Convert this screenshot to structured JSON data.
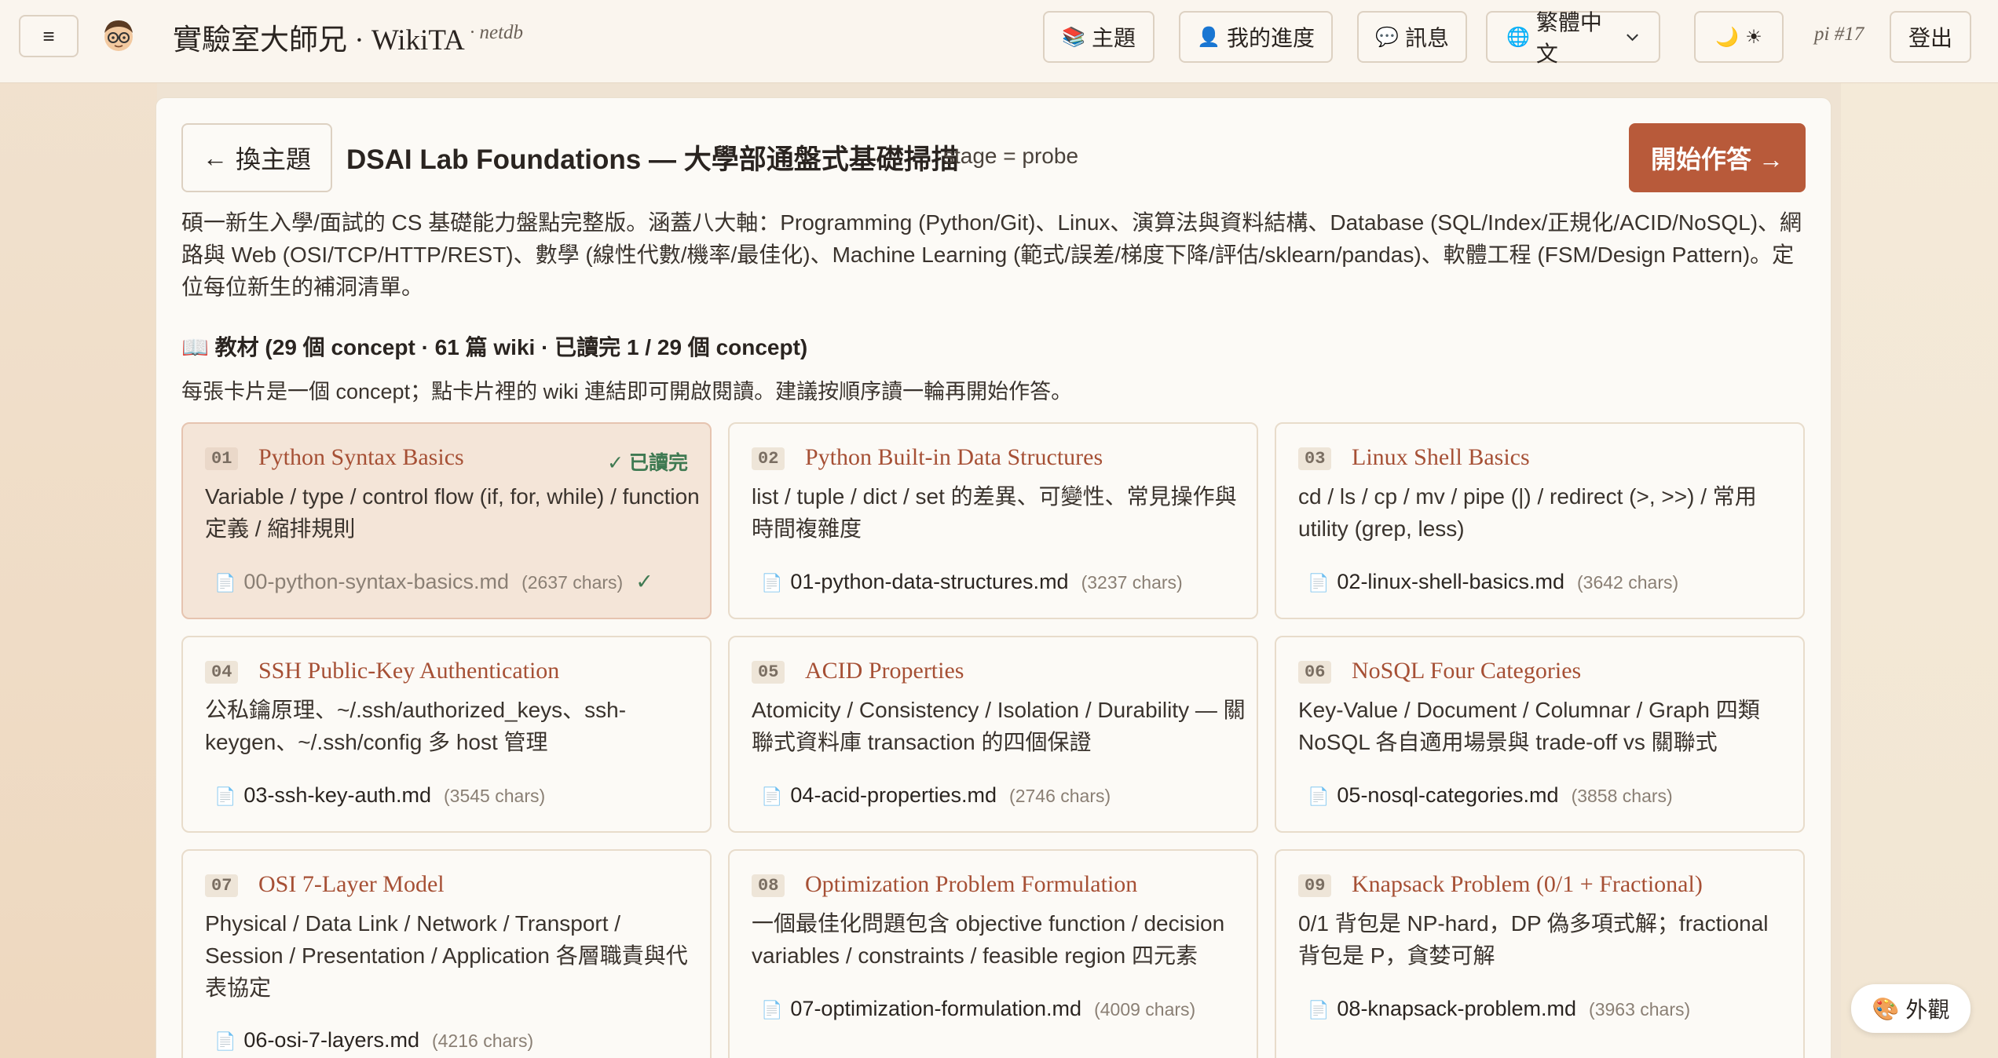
{
  "header": {
    "menu_icon": "hamburger-icon",
    "brand": "實驗室大師兄 · WikiTA",
    "brand_sub": "· netdb",
    "nav": {
      "topics": "主題",
      "progress": "我的進度",
      "messages": "訊息",
      "language": "繁體中文",
      "pi": "pi #17",
      "logout": "登出"
    }
  },
  "page": {
    "back_label": "換主題",
    "title": "DSAI Lab Foundations — 大學部通盤式基礎掃描",
    "stage": "stage = probe",
    "start_label": "開始作答 →",
    "description": "碩一新生入學/面試的 CS 基礎能力盤點完整版。涵蓋八大軸：Programming (Python/Git)、Linux、演算法與資料結構、Database (SQL/Index/正規化/ACID/NoSQL)、網路與 Web (OSI/TCP/HTTP/REST)、數學 (線性代數/機率/最佳化)、Machine Learning (範式/誤差/梯度下降/評估/sklearn/pandas)、軟體工程 (FSM/Design Pattern)。定位每位新生的補洞清單。",
    "section_head": "📖 教材 (29 個 concept · 61 篇 wiki · 已讀完 1 / 29 個 concept)",
    "section_sub": "每張卡片是一個 concept；點卡片裡的 wiki 連結即可開啟閱讀。建議按順序讀一輪再開始作答。"
  },
  "cards": [
    {
      "num": "01",
      "title": "Python Syntax Basics",
      "desc": "Variable / type / control flow (if, for, while) / function 定義 / 縮排規則",
      "file": "00-python-syntax-basics.md",
      "chars": "(2637 chars)",
      "read": true,
      "read_label": "✓ 已讀完",
      "check": "✓"
    },
    {
      "num": "02",
      "title": "Python Built-in Data Structures",
      "desc": "list / tuple / dict / set 的差異、可變性、常見操作與時間複雜度",
      "file": "01-python-data-structures.md",
      "chars": "(3237 chars)",
      "read": false
    },
    {
      "num": "03",
      "title": "Linux Shell Basics",
      "desc": "cd / ls / cp / mv / pipe (|) / redirect (>, >>) / 常用 utility (grep, less)",
      "file": "02-linux-shell-basics.md",
      "chars": "(3642 chars)",
      "read": false
    },
    {
      "num": "04",
      "title": "SSH Public-Key Authentication",
      "desc": "公私鑰原理、~/.ssh/authorized_keys、ssh-keygen、~/.ssh/config 多 host 管理",
      "file": "03-ssh-key-auth.md",
      "chars": "(3545 chars)",
      "read": false
    },
    {
      "num": "05",
      "title": "ACID Properties",
      "desc": "Atomicity / Consistency / Isolation / Durability — 關聯式資料庫 transaction 的四個保證",
      "file": "04-acid-properties.md",
      "chars": "(2746 chars)",
      "read": false
    },
    {
      "num": "06",
      "title": "NoSQL Four Categories",
      "desc": "Key-Value / Document / Columnar / Graph 四類 NoSQL 各自適用場景與 trade-off vs 關聯式",
      "file": "05-nosql-categories.md",
      "chars": "(3858 chars)",
      "read": false
    },
    {
      "num": "07",
      "title": "OSI 7-Layer Model",
      "desc": "Physical / Data Link / Network / Transport / Session / Presentation / Application 各層職責與代表協定",
      "file": "06-osi-7-layers.md",
      "chars": "(4216 chars)",
      "read": false
    },
    {
      "num": "08",
      "title": "Optimization Problem Formulation",
      "desc": "一個最佳化問題包含 objective function / decision variables / constraints / feasible region 四元素",
      "file": "07-optimization-formulation.md",
      "chars": "(4009 chars)",
      "read": false
    },
    {
      "num": "09",
      "title": "Knapsack Problem (0/1 + Fractional)",
      "desc": "0/1 背包是 NP-hard，DP 偽多項式解；fractional 背包是 P，貪婪可解",
      "file": "08-knapsack-problem.md",
      "chars": "(3963 chars)",
      "read": false
    }
  ],
  "appearance_label": "外觀",
  "colors": {
    "accent": "#b85a3a",
    "card_title": "#a65035",
    "read_green": "#3f7a52",
    "read_card_bg": "#f4e5d8"
  }
}
